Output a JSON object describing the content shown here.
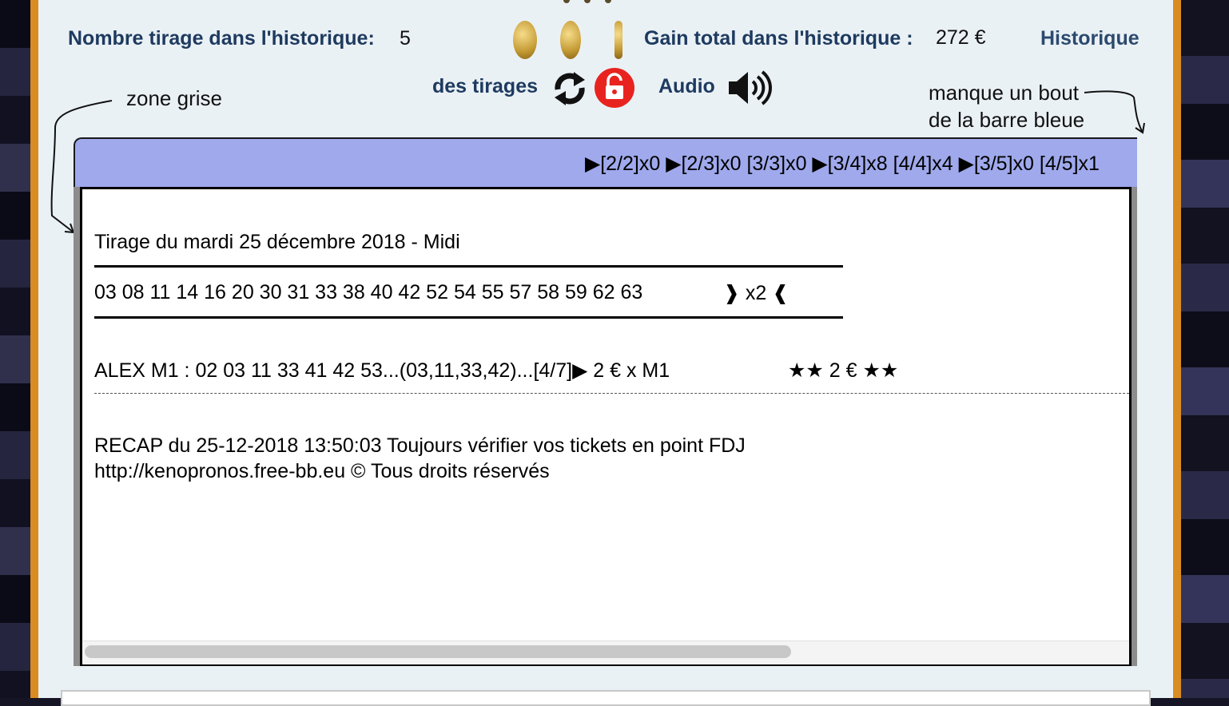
{
  "header": {
    "draw_count_label": "Nombre tirage dans l'historique:",
    "draw_count_value": "5",
    "gain_label": "Gain total dans l'historique :",
    "gain_value": "272 €",
    "historique_link": "Historique",
    "des_tirages_label": "des tirages",
    "audio_label": "Audio"
  },
  "icons": {
    "coins": [
      "coin-front-icon",
      "coin-tilted-icon",
      "coin-edge-icon"
    ],
    "refresh": "refresh-icon",
    "lock": "lock-icon",
    "speaker": "speaker-icon",
    "lock_color": "#e8231f"
  },
  "annotations": {
    "zone_grise": "zone grise",
    "manque_line1": "manque un bout",
    "manque_line2": "de la barre bleue"
  },
  "blue_bar": {
    "text": "▶[2/2]x0   ▶[2/3]x0  [3/3]x0   ▶[3/4]x8  [4/4]x4   ▶[3/5]x0  [4/5]x1",
    "color": "#9fa9ec"
  },
  "content": {
    "draw_title": "Tirage du mardi 25 décembre 2018 - Midi",
    "numbers": "03 08 11 14 16 20 30 31 33 38 40 42 52 54 55 57 58 59 62 63",
    "multiplier": "❱ x2 ❰",
    "player_line": "ALEX M1 :  02 03 11 33 41 42 53...(03,11,33,42)...[4/7]▶  2 € x M1",
    "player_gain": "★★ 2 € ★★",
    "recap_line1": "RECAP du 25-12-2018 13:50:03 Toujours vérifier vos tickets en point FDJ",
    "recap_line2": "http://kenopronos.free-bb.eu  © Tous droits réservés"
  },
  "colors": {
    "frame": "#d98c21",
    "panel": "#eaf1f5",
    "label": "#1e3a5f"
  }
}
